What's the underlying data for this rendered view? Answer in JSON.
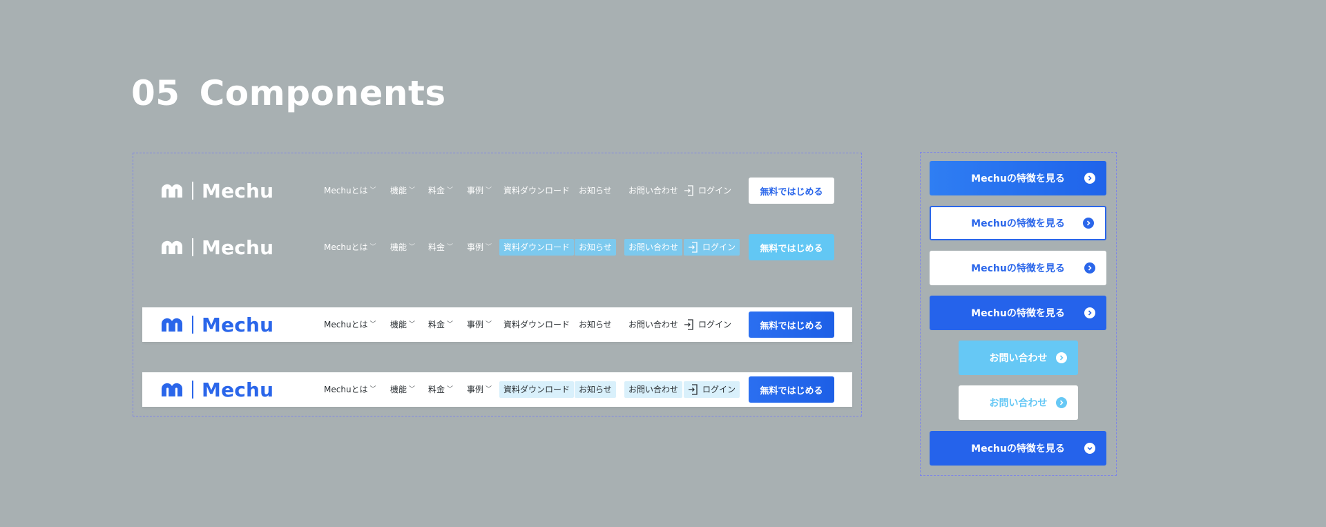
{
  "page": {
    "section_number": "05",
    "section_title": "Components"
  },
  "colors": {
    "background": "#a8b0b2",
    "brand_blue": "#2a66ea",
    "light_blue": "#66c8f5",
    "highlight_light": "#d9f0fb",
    "frame_dash": "#7f86e6"
  },
  "header": {
    "brand_name": "Mechu",
    "nav": {
      "about": "Mechuとは",
      "features": "機能",
      "pricing": "料金",
      "cases": "事例",
      "download": "資料ダウンロード",
      "news": "お知らせ",
      "contact": "お問い合わせ",
      "login": "ログイン"
    },
    "cta_label": "無料ではじめる",
    "variants": [
      "transparent-default",
      "transparent-hover",
      "white-default",
      "white-hover"
    ]
  },
  "buttons": [
    {
      "label": "Mechuの特徴を見る",
      "style": "gradient",
      "icon": "chevron-right-icon"
    },
    {
      "label": "Mechuの特徴を見る",
      "style": "outline",
      "icon": "chevron-right-icon"
    },
    {
      "label": "Mechuの特徴を見る",
      "style": "white",
      "icon": "chevron-right-icon"
    },
    {
      "label": "Mechuの特徴を見る",
      "style": "solid",
      "icon": "chevron-right-icon"
    },
    {
      "label": "お問い合わせ",
      "style": "light-blue",
      "icon": "chevron-right-icon"
    },
    {
      "label": "お問い合わせ",
      "style": "white-light",
      "icon": "chevron-right-icon"
    },
    {
      "label": "Mechuの特徴を見る",
      "style": "solid",
      "icon": "chevron-down-icon"
    }
  ]
}
